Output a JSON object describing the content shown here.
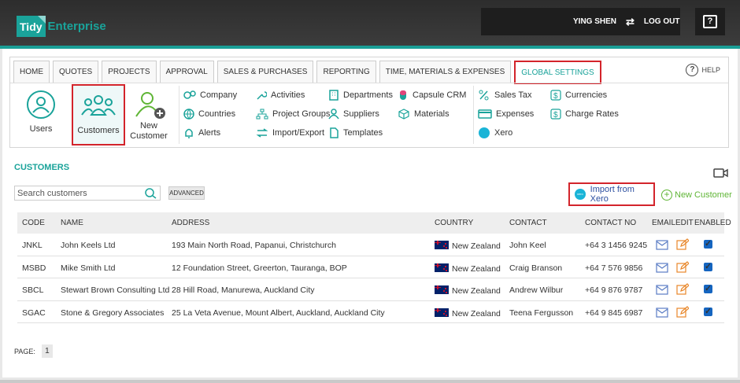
{
  "brand": {
    "tidy": "Tidy",
    "enterprise": "Enterprise"
  },
  "user": {
    "name": "YING SHEN",
    "logout": "LOG OUT"
  },
  "tabs": [
    "HOME",
    "QUOTES",
    "PROJECTS",
    "APPROVAL",
    "SALES & PURCHASES",
    "REPORTING",
    "TIME, MATERIALS & EXPENSES",
    "GLOBAL SETTINGS"
  ],
  "help": "HELP",
  "big_icons": {
    "users": "Users",
    "customers": "Customers",
    "new_customer_1": "New",
    "new_customer_2": "Customer"
  },
  "menu": {
    "company": "Company",
    "countries": "Countries",
    "alerts": "Alerts",
    "activities": "Activities",
    "project_groups": "Project Groups",
    "import_export": "Import/Export",
    "departments": "Departments",
    "suppliers": "Suppliers",
    "templates": "Templates",
    "capsule_crm": "Capsule CRM",
    "materials": "Materials",
    "sales_tax": "Sales Tax",
    "expenses": "Expenses",
    "xero": "Xero",
    "currencies": "Currencies",
    "charge_rates": "Charge Rates"
  },
  "page_title": "CUSTOMERS",
  "search": {
    "placeholder": "Search customers"
  },
  "advanced": "ADVANCED",
  "import_xero": "Import from Xero",
  "xero_logo": "xero",
  "new_customer": "New Customer",
  "columns": [
    "CODE",
    "NAME",
    "ADDRESS",
    "COUNTRY",
    "CONTACT",
    "CONTACT NO",
    "EMAIL",
    "EDIT",
    "ENABLED"
  ],
  "rows": [
    {
      "code": "JNKL",
      "name": "John Keels Ltd",
      "address": "193 Main North Road, Papanui, Christchurch",
      "country": "New Zealand",
      "contact": "John Keel",
      "phone": "+64 3 1456 9245"
    },
    {
      "code": "MSBD",
      "name": "Mike Smith Ltd",
      "address": "12 Foundation Street, Greerton, Tauranga, BOP",
      "country": "New Zealand",
      "contact": "Craig Branson",
      "phone": "+64 7 576 9856"
    },
    {
      "code": "SBCL",
      "name": "Stewart Brown Consulting Ltd",
      "address": "28 Hill Road, Manurewa, Auckland City",
      "country": "New Zealand",
      "contact": "Andrew Wilbur",
      "phone": "+64 9 876 9787"
    },
    {
      "code": "SGAC",
      "name": "Stone & Gregory Associates",
      "address": "25 La Veta Avenue, Mount Albert, Auckland, Auckland City",
      "country": "New Zealand",
      "contact": "Teena Fergusson",
      "phone": "+64 9 845 6987"
    }
  ],
  "pagination": {
    "label": "PAGE:",
    "current": "1"
  },
  "colors": {
    "teal": "#1aa39a",
    "highlight": "#d3242b",
    "link": "#2c4fa0",
    "green": "#5fb535"
  }
}
